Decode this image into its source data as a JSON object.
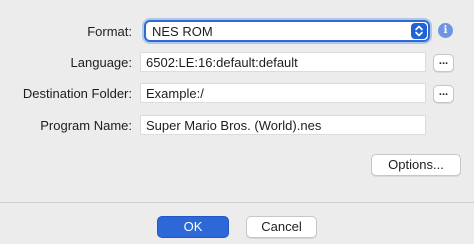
{
  "form": {
    "format": {
      "label": "Format:",
      "value": "NES ROM"
    },
    "language": {
      "label": "Language:",
      "value": "6502:LE:16:default:default",
      "browse_label": "..."
    },
    "destination": {
      "label": "Destination Folder:",
      "value": "Example:/",
      "browse_label": "..."
    },
    "program_name": {
      "label": "Program Name:",
      "value": "Super Mario Bros. (World).nes"
    }
  },
  "info_icon_glyph": "i",
  "buttons": {
    "options": "Options...",
    "ok": "OK",
    "cancel": "Cancel"
  },
  "colors": {
    "accent": "#2c68d8",
    "background": "#ececec"
  }
}
